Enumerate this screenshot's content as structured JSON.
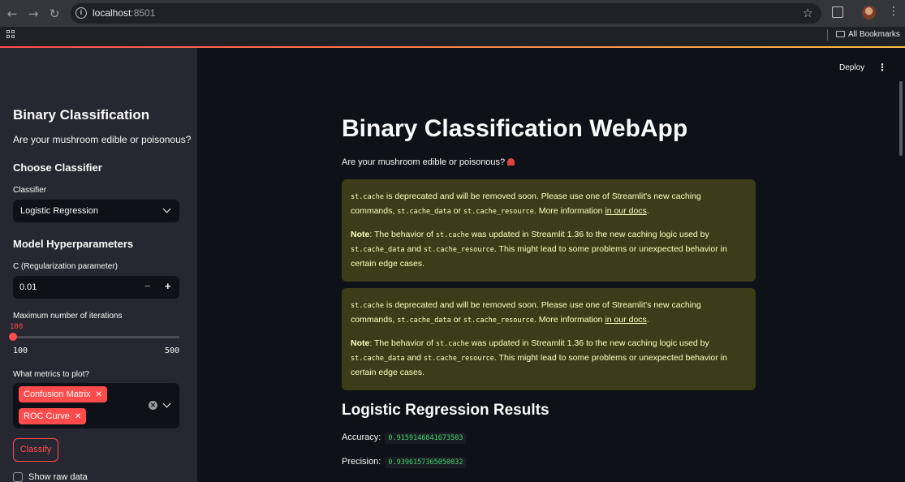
{
  "browser": {
    "url_host": "localhost",
    "url_port": ":8501",
    "bookmarks_label": "All Bookmarks",
    "icons": [
      "back-icon",
      "forward-icon",
      "reload-icon",
      "info-icon",
      "star-icon",
      "extensions-icon",
      "profile-avatar",
      "menu-icon",
      "apps-icon",
      "folder-icon"
    ]
  },
  "colors": {
    "accent": "#ff4b4b",
    "warning_bg": "#3d3c19",
    "warning_text": "#ffffc2",
    "code_green": "#3dd56d"
  },
  "sidebar": {
    "title": "Binary Classification",
    "subtitle": "Are your mushroom edible or poisonous?",
    "choose_classifier": "Choose Classifier",
    "classifier_label": "Classifier",
    "classifier_value": "Logistic Regression",
    "hyperparams_heading": "Model Hyperparameters",
    "c_label": "C (Regularization parameter)",
    "c_value": "0.01",
    "minus": "−",
    "plus": "+",
    "iter_label": "Maximum number of iterations",
    "iter_value": "100",
    "iter_min": "100",
    "iter_max": "500",
    "metrics_label": "What metrics to plot?",
    "metrics": [
      "Confusion Matrix",
      "ROC Curve"
    ],
    "classify_label": "Classify",
    "raw_data_label": "Show raw data"
  },
  "main": {
    "deploy_label": "Deploy",
    "title": "Binary Classification WebApp",
    "lead": "Are your mushroom edible or poisonous?",
    "warning": {
      "code_cache": "st.cache",
      "line1a": " is deprecated and will be removed soon. Please use one of Streamlit's new caching commands, ",
      "code_data": "st.cache_data",
      "or": " or ",
      "code_resource": "st.cache_resource",
      "line1b": ". More information ",
      "link": "in our docs",
      "period": ".",
      "note_bold": "Note",
      "note_a": ": The behavior of ",
      "note_b": " was updated in Streamlit 1.36 to the new caching logic used by ",
      "and": " and ",
      "note_c": ". This might lead to some problems or unexpected behavior in certain edge cases."
    },
    "results_heading": "Logistic Regression Results",
    "accuracy_label": "Accuracy:",
    "accuracy_value": "0.9159146841673503",
    "precision_label": "Precision:",
    "precision_value": "0.9396157365050032"
  }
}
